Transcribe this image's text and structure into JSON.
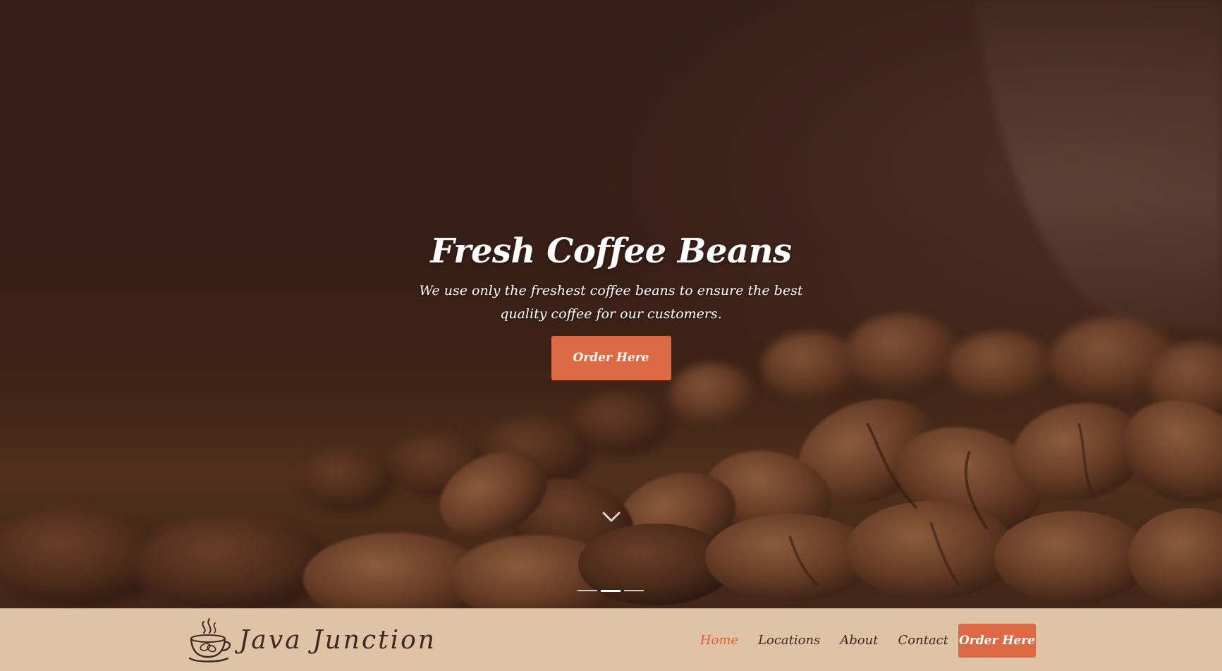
{
  "hero": {
    "title": "Fresh Coffee Beans",
    "subtitle": "We use only the freshest coffee beans to ensure the best quality coffee for our customers.",
    "cta_label": "Order Here",
    "scroll_icon": "chevron-down-icon",
    "slides": [
      {
        "label": "slide-1",
        "active": false
      },
      {
        "label": "slide-2",
        "active": true
      },
      {
        "label": "slide-3",
        "active": false
      }
    ]
  },
  "navbar": {
    "brand_name": "Java Junction",
    "brand_icon": "coffee-cup-icon",
    "links": [
      {
        "label": "Home",
        "active": true
      },
      {
        "label": "Locations",
        "active": false
      },
      {
        "label": "About",
        "active": false
      },
      {
        "label": "Contact",
        "active": false
      }
    ],
    "cta_label": "Order Here"
  },
  "colors": {
    "accent": "#dc6a44",
    "active_link": "#d9643c",
    "navbar_bg": "#dfc3a4",
    "text_dark": "#3b2a22",
    "hero_bg": "#3a2219"
  }
}
